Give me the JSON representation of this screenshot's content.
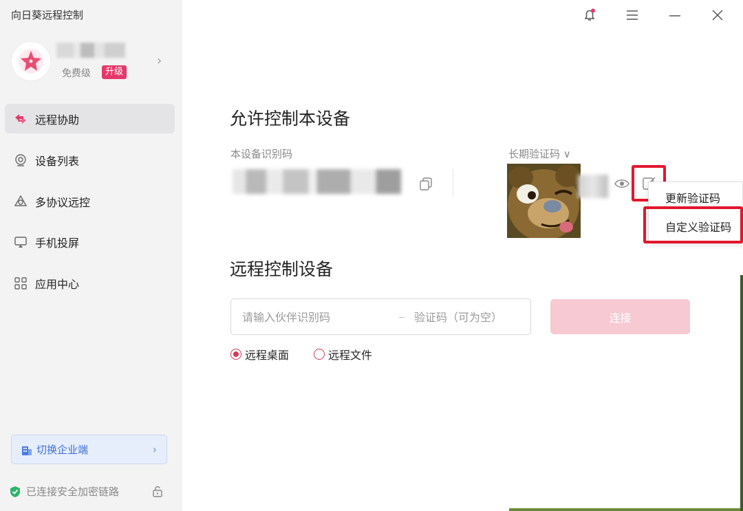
{
  "app": {
    "title": "向日葵远程控制"
  },
  "profile": {
    "tier": "免费级",
    "upgrade": "升级",
    "chevron": "›"
  },
  "nav": {
    "items": [
      {
        "label": "远程协助",
        "icon": "remote-assist-icon"
      },
      {
        "label": "设备列表",
        "icon": "device-list-icon"
      },
      {
        "label": "多协议远控",
        "icon": "multi-protocol-icon"
      },
      {
        "label": "手机投屏",
        "icon": "screen-cast-icon"
      },
      {
        "label": "应用中心",
        "icon": "app-center-icon"
      }
    ],
    "active_index": 0
  },
  "enterprise": {
    "label": "切换企业端",
    "chevron": "›"
  },
  "status": {
    "secure": "已连接安全加密链路"
  },
  "window_controls": [
    "bell-icon",
    "menu-icon",
    "minimize-icon",
    "close-icon"
  ],
  "allow_control": {
    "title": "允许控制本设备",
    "device_id_label": "本设备识别码",
    "password_label": "长期验证码 ∨"
  },
  "password_menu": {
    "items": [
      "更新验证码",
      "自定义验证码"
    ]
  },
  "remote_control": {
    "title": "远程控制设备",
    "partner_placeholder": "请输入伙伴识别码",
    "code_placeholder": "验证码（可为空）",
    "connect_label": "连接",
    "modes": [
      {
        "label": "远程桌面",
        "checked": true
      },
      {
        "label": "远程文件",
        "checked": false
      }
    ]
  },
  "colors": {
    "accent": "#e5386a",
    "highlight": "#e3162d",
    "connect_disabled": "#f6c9d3",
    "enterprise": "#3e6fd6"
  }
}
